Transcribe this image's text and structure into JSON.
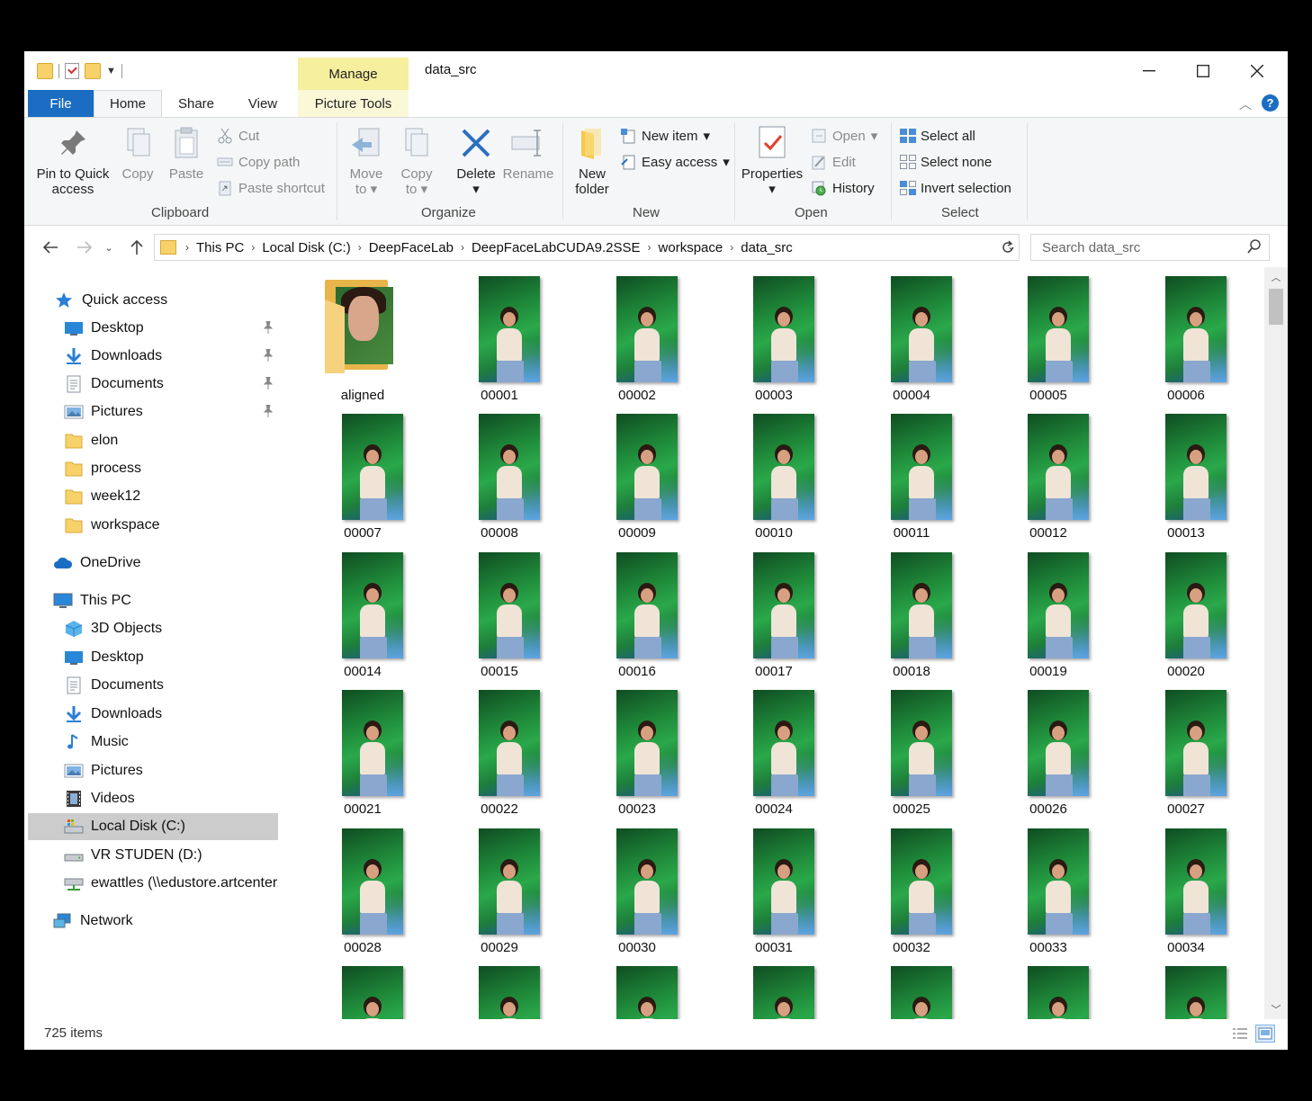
{
  "window": {
    "title": "data_src",
    "manage_label": "Manage",
    "controls": {
      "minimize": "—",
      "maximize": "☐",
      "close": "✕"
    }
  },
  "ribbon_tabs": {
    "file": "File",
    "home": "Home",
    "share": "Share",
    "view": "View",
    "picture_tools": "Picture Tools"
  },
  "ribbon": {
    "clipboard": {
      "label": "Clipboard",
      "pin": "Pin to Quick access",
      "pin_l1": "Pin to Quick",
      "pin_l2": "access",
      "copy": "Copy",
      "paste": "Paste",
      "cut": "Cut",
      "copy_path": "Copy path",
      "paste_shortcut": "Paste shortcut"
    },
    "organize": {
      "label": "Organize",
      "move_l1": "Move",
      "move_l2": "to",
      "copy_l1": "Copy",
      "copy_l2": "to",
      "delete": "Delete",
      "rename": "Rename"
    },
    "new": {
      "label": "New",
      "new_folder_l1": "New",
      "new_folder_l2": "folder",
      "new_item": "New item",
      "easy_access": "Easy access"
    },
    "open": {
      "label": "Open",
      "properties": "Properties",
      "open": "Open",
      "edit": "Edit",
      "history": "History"
    },
    "select": {
      "label": "Select",
      "select_all": "Select all",
      "select_none": "Select none",
      "invert": "Invert selection"
    }
  },
  "address": {
    "crumbs": [
      "This PC",
      "Local Disk (C:)",
      "DeepFaceLab",
      "DeepFaceLabCUDA9.2SSE",
      "workspace",
      "data_src"
    ],
    "search_placeholder": "Search data_src"
  },
  "nav": {
    "quick_access": "Quick access",
    "qa_items": [
      "Desktop",
      "Downloads",
      "Documents",
      "Pictures",
      "elon",
      "process",
      "week12",
      "workspace"
    ],
    "onedrive": "OneDrive",
    "this_pc": "This PC",
    "pc_items": [
      "3D Objects",
      "Desktop",
      "Documents",
      "Downloads",
      "Music",
      "Pictures",
      "Videos",
      "Local Disk (C:)",
      "VR STUDEN (D:)",
      "ewattles (\\\\edustore.artcenter."
    ],
    "network": "Network"
  },
  "files": {
    "folder": "aligned",
    "items": [
      "00001",
      "00002",
      "00003",
      "00004",
      "00005",
      "00006",
      "00007",
      "00008",
      "00009",
      "00010",
      "00011",
      "00012",
      "00013",
      "00014",
      "00015",
      "00016",
      "00017",
      "00018",
      "00019",
      "00020",
      "00021",
      "00022",
      "00023",
      "00024",
      "00025",
      "00026",
      "00027",
      "00028",
      "00029",
      "00030",
      "00031",
      "00032",
      "00033",
      "00034"
    ]
  },
  "status": {
    "count": "725 items"
  },
  "colors": {
    "accent": "#1a6dc2",
    "manage_bg": "#f6ef9e",
    "folder": "#f7d26a",
    "selected_nav": "#cccccc"
  }
}
